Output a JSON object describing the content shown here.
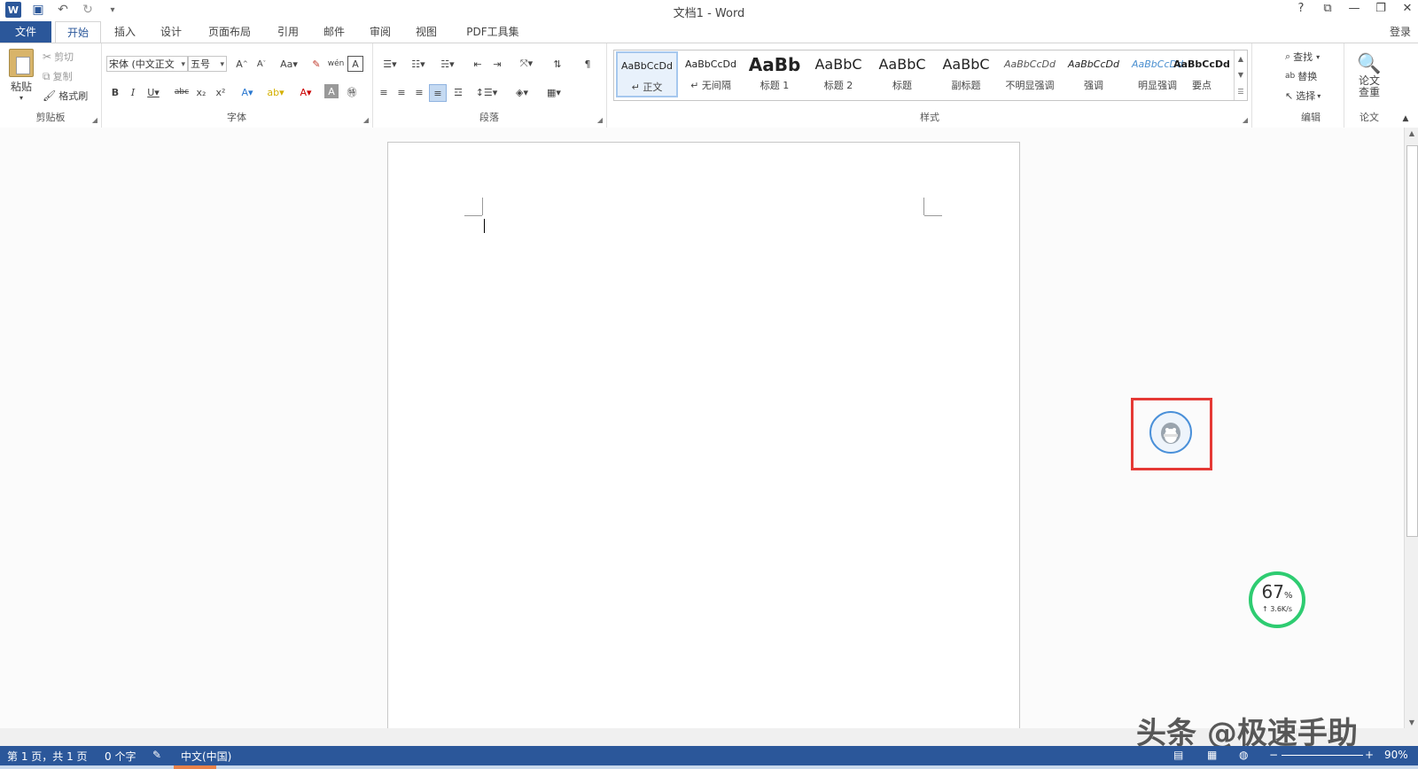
{
  "window": {
    "title": "文档1 - Word",
    "controls": [
      "?",
      "⧉",
      "—",
      "❐",
      "✕"
    ]
  },
  "quick_access": {
    "icons": [
      "word-logo",
      "save-icon",
      "undo-icon",
      "redo-icon",
      "customize-icon"
    ]
  },
  "tabs": {
    "file": "文件",
    "items": [
      "开始",
      "插入",
      "设计",
      "页面布局",
      "引用",
      "邮件",
      "审阅",
      "视图",
      "PDF工具集"
    ],
    "active": "开始",
    "login": "登录"
  },
  "clipboard": {
    "label": "剪贴板",
    "paste": "粘贴",
    "cut": "剪切",
    "copy": "复制",
    "format_painter": "格式刷"
  },
  "font": {
    "label": "字体",
    "font_name": "宋体 (中文正文",
    "font_size": "五号"
  },
  "paragraph": {
    "label": "段落"
  },
  "styles": {
    "label": "样式",
    "items": [
      {
        "sample": "AaBbCcDd",
        "name": "↵ 正文"
      },
      {
        "sample": "AaBbCcDd",
        "name": "↵ 无间隔"
      },
      {
        "sample": "AaBb",
        "name": "标题 1"
      },
      {
        "sample": "AaBbC",
        "name": "标题 2"
      },
      {
        "sample": "AaBbC",
        "name": "标题"
      },
      {
        "sample": "AaBbC",
        "name": "副标题"
      },
      {
        "sample": "AaBbCcDd",
        "name": "不明显强调"
      },
      {
        "sample": "AaBbCcDd",
        "name": "强调"
      },
      {
        "sample": "AaBbCcDd",
        "name": "明显强调"
      },
      {
        "sample": "AaBbCcDd",
        "name": "要点"
      }
    ]
  },
  "editing": {
    "label": "编辑",
    "find": "查找",
    "replace": "替换",
    "select": "选择"
  },
  "paper": {
    "label": "论文",
    "check": "论文\n查重"
  },
  "speed_widget": {
    "percent": "67",
    "percent_unit": "%",
    "rate": "↑ 3.6K/s"
  },
  "watermark": "头条 @极速手助",
  "statusbar": {
    "page": "第 1 页，共 1 页",
    "words": "0 个字",
    "language": "中文(中国)",
    "zoom": "90%"
  },
  "colors": {
    "accent": "#2b579a",
    "highlight_box": "#e53935",
    "speed_ring": "#2ecc71"
  }
}
